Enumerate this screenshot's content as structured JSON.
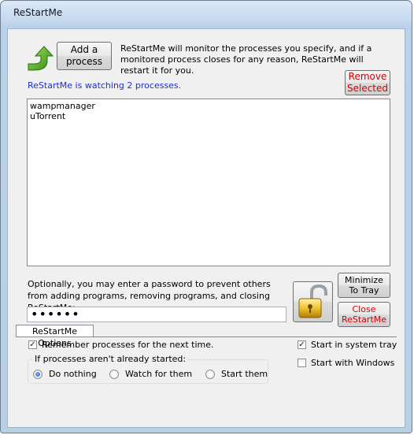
{
  "window": {
    "title": "ReStartMe"
  },
  "toolbar": {
    "add_label": "Add a\nprocess",
    "description": "ReStartMe will monitor the processes you specify, and if a monitored process closes for any reason, ReStartMe will restart it for you.",
    "remove_label": "Remove\nSelected"
  },
  "status": {
    "text": "ReStartMe is watching 2 processes."
  },
  "processes": [
    "wampmanager",
    "uTorrent"
  ],
  "password": {
    "description": "Optionally, you may enter a password to prevent others from adding programs, removing programs, and closing ReStartMe:",
    "value": "••••••"
  },
  "buttons": {
    "minimize": "Minimize\nTo Tray",
    "close": "Close\nReStartMe"
  },
  "options": {
    "tab_label": "ReStartMe Options",
    "remember": {
      "label": "Remember processes for the next time.",
      "checked": true
    },
    "tray": {
      "label": "Start in system tray",
      "checked": true
    },
    "windows": {
      "label": "Start with Windows",
      "checked": false
    },
    "group_label": "If processes aren't already started:",
    "radios": [
      {
        "label": "Do nothing",
        "selected": true
      },
      {
        "label": "Watch for them",
        "selected": false
      },
      {
        "label": "Start them",
        "selected": false
      }
    ]
  },
  "colors": {
    "status": "#1c2fd0",
    "danger": "#d40000"
  }
}
